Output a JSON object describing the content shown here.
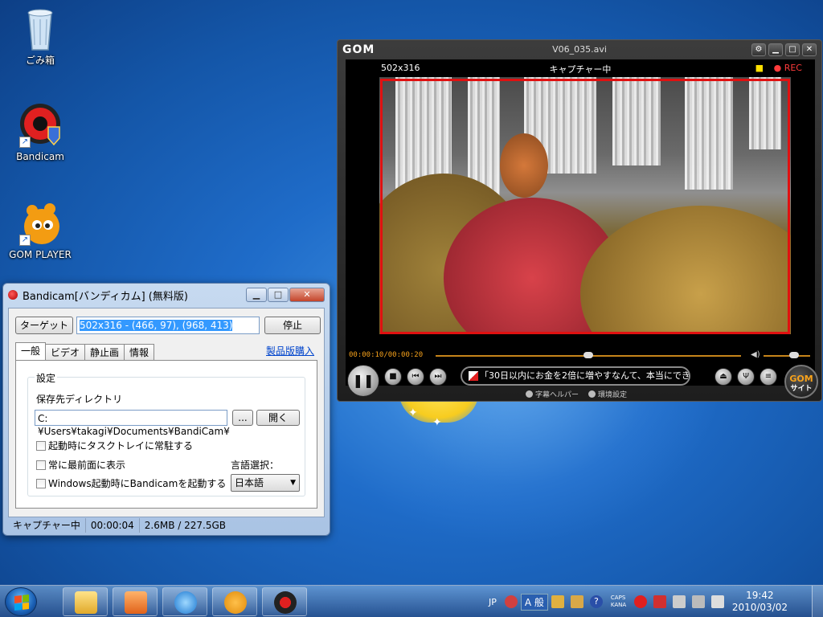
{
  "desktop": {
    "icons": [
      {
        "label": "ごみ箱"
      },
      {
        "label": "Bandicam"
      },
      {
        "label": "GOM PLAYER"
      }
    ]
  },
  "bandicam": {
    "title": "Bandicam[バンディカム] (無料版)",
    "target_button": "ターゲット",
    "target_value": "502x316 - (466, 97), (968, 413)",
    "stop_button": "停止",
    "tabs": [
      "一般",
      "ビデオ",
      "静止画",
      "情報"
    ],
    "purchase_link": "製品版購入",
    "group_label": "設定",
    "save_dir_label": "保存先ディレクトリ",
    "save_dir_value": "C:¥Users¥takagi¥Documents¥BandiCam¥",
    "browse_button": "...",
    "open_button": "開く",
    "checkboxes": [
      "起動時にタスクトレイに常駐する",
      "常に最前面に表示",
      "Windows起動時にBandicamを起動する"
    ],
    "language_label": "言語選択：",
    "language_value": "日本語",
    "status": {
      "state": "キャプチャー中",
      "elapsed": "00:00:04",
      "size": "2.6MB / 227.5GB"
    }
  },
  "gom": {
    "logo": "GOM",
    "filename": "V06_035.avi",
    "resolution": "502x316",
    "capturing": "キャプチャー中",
    "rec": "REC",
    "time": "00:00:10/00:00:20",
    "progress": 0.5,
    "subtitle": "「30日以内にお金を2倍に増やすなんて、本当にでき",
    "helper1": "字幕ヘルパー",
    "helper2": "環境設定",
    "site_label_top": "GOM",
    "site_label_bottom": "サイト"
  },
  "taskbar": {
    "ime": "JP",
    "ime_mode": "A 般",
    "caps": "CAPS",
    "kana": "KANA",
    "time": "19:42",
    "date": "2010/03/02"
  },
  "colors": {
    "rec_frame": "#e01010",
    "gom_accent": "#f7a21b",
    "selection": "#3399ff"
  }
}
